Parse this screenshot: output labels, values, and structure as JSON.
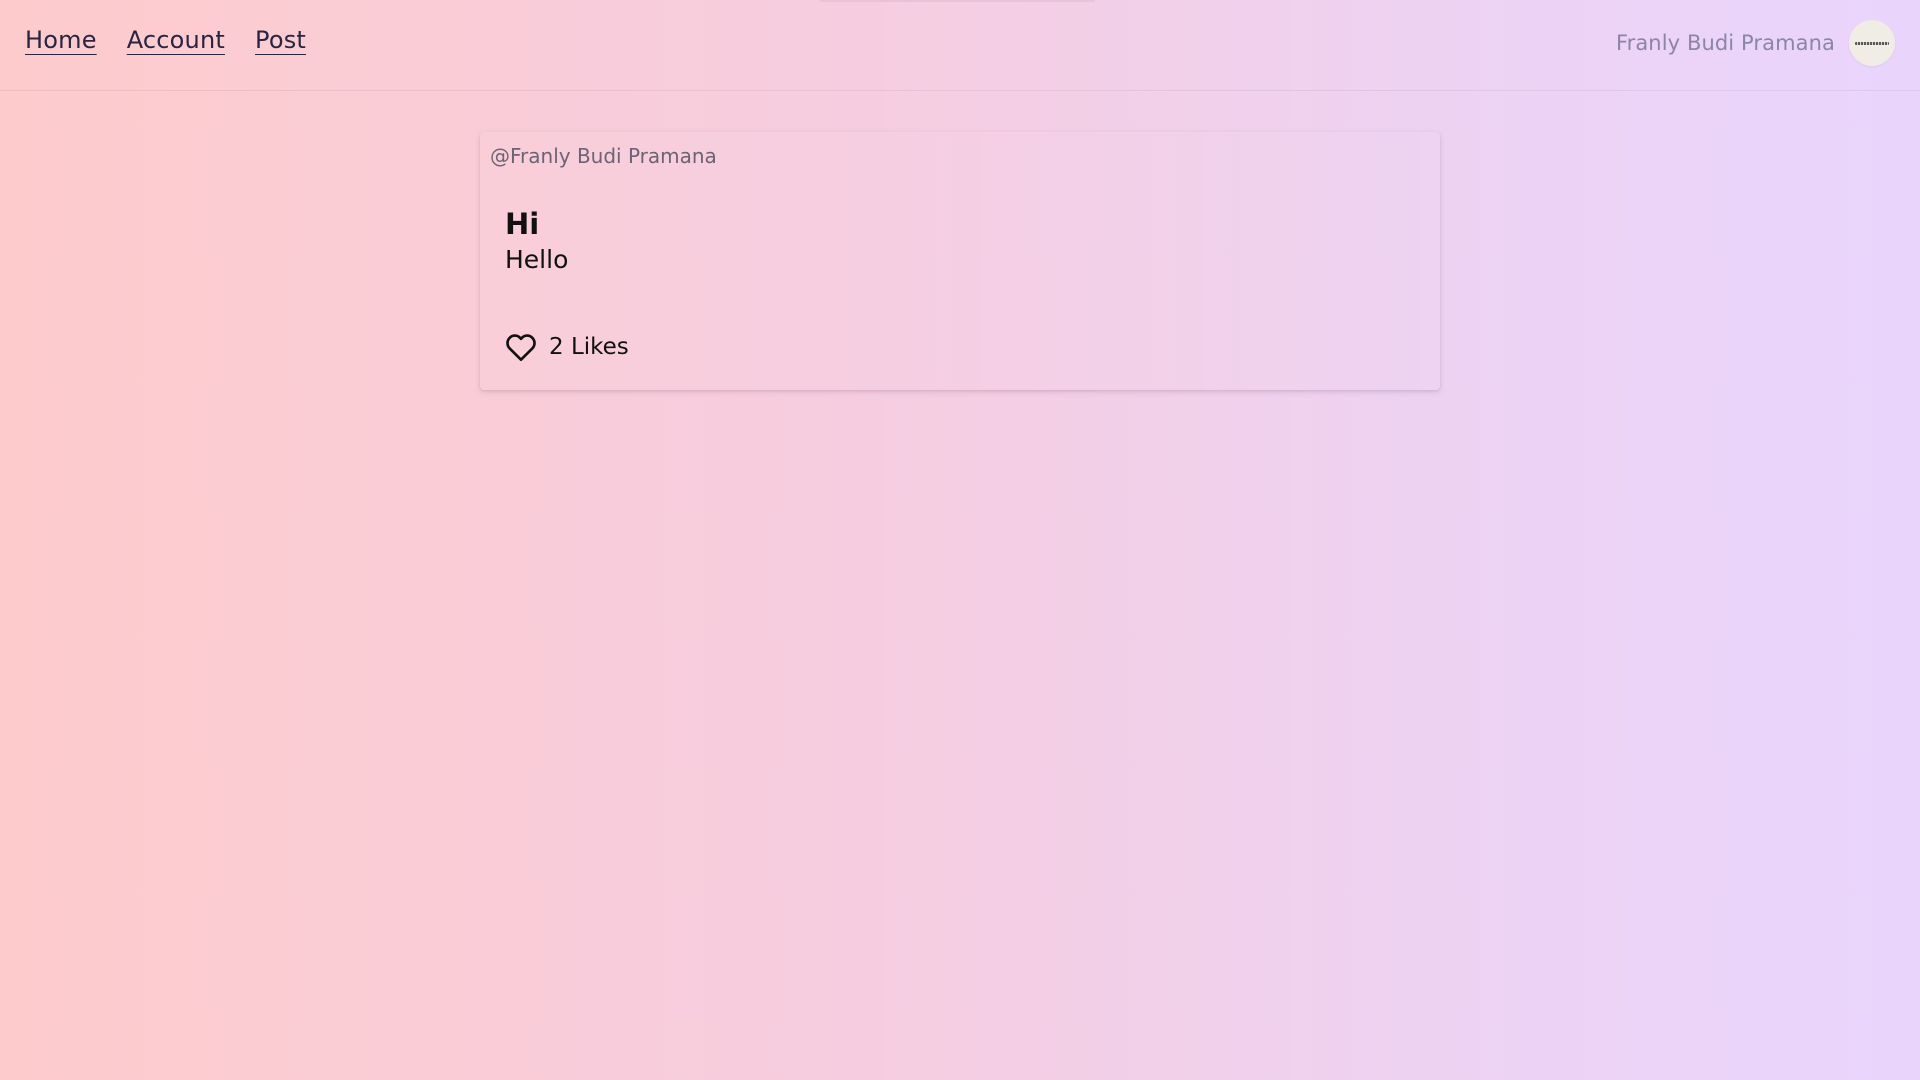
{
  "nav": {
    "links": [
      {
        "label": "Home"
      },
      {
        "label": "Account"
      },
      {
        "label": "Post"
      }
    ]
  },
  "user": {
    "name": "Franly Budi Pramana",
    "avatar_icon": "avatar-image"
  },
  "post": {
    "author": "@Franly Budi Pramana",
    "title": "Hi",
    "body": "Hello",
    "likes_label": "2 Likes",
    "like_icon": "heart-outline-icon"
  },
  "colors": {
    "gradient_start": "#fdcbcc",
    "gradient_end": "#e9d5fc",
    "nav_text": "#2a2440",
    "muted_text": "#8b85a6"
  }
}
